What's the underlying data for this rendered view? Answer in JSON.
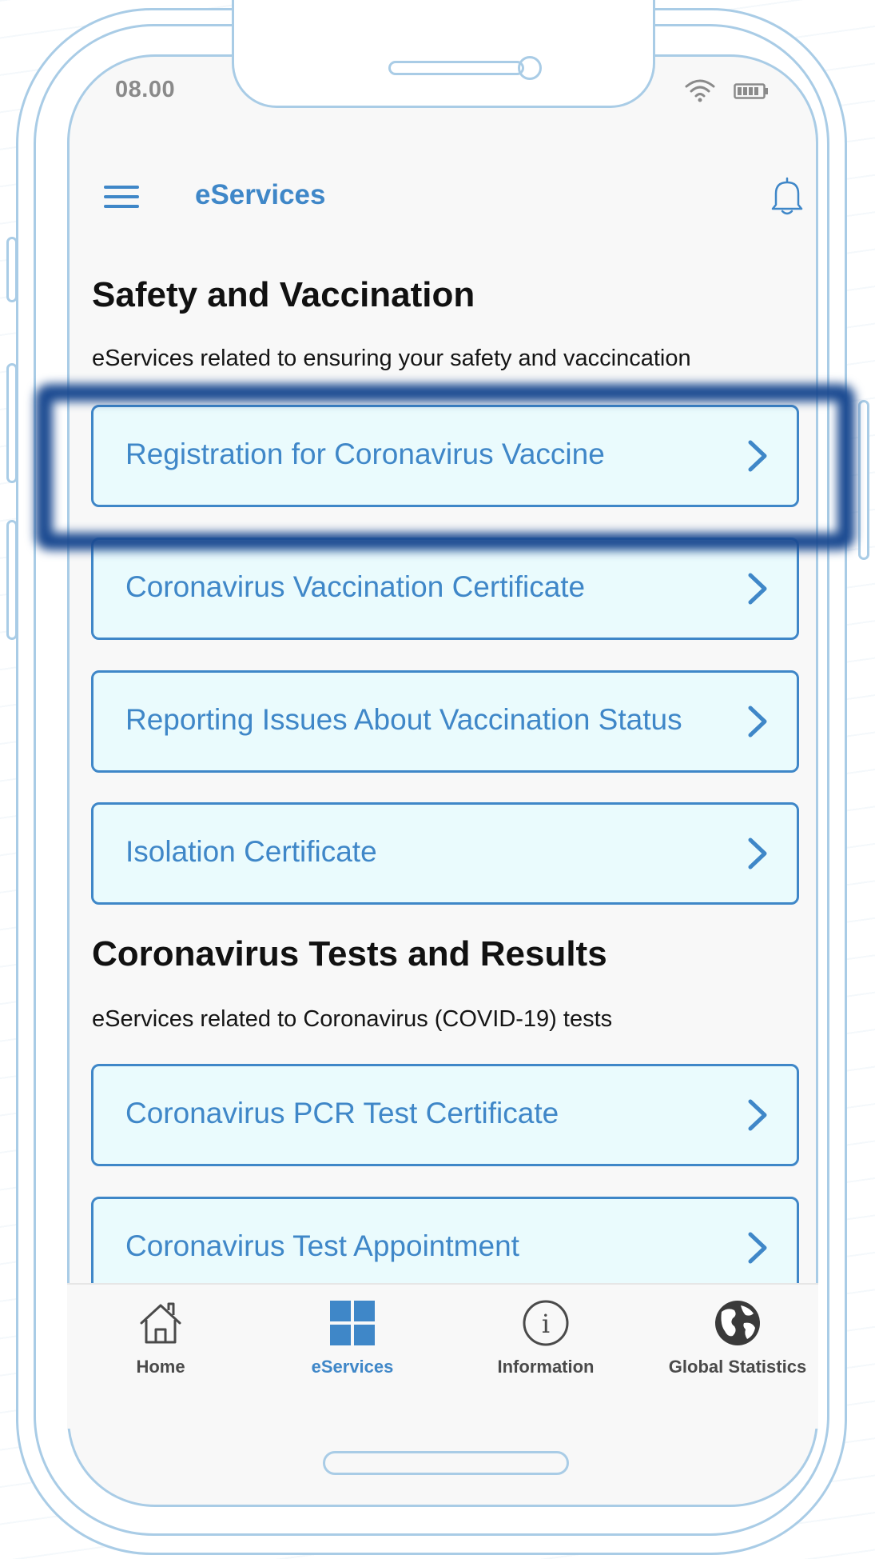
{
  "status_bar": {
    "time": "08.00"
  },
  "header": {
    "title": "eServices"
  },
  "sections": [
    {
      "title": "Safety and Vaccination",
      "description": "eServices related to ensuring your safety and vaccincation",
      "items": [
        {
          "label": "Registration for Coronavirus Vaccine"
        },
        {
          "label": "Coronavirus Vaccination Certificate"
        },
        {
          "label": "Reporting Issues About Vaccination Status"
        },
        {
          "label": "Isolation Certificate"
        }
      ]
    },
    {
      "title": "Coronavirus Tests and Results",
      "description": "eServices related to Coronavirus (COVID-19) tests",
      "items": [
        {
          "label": "Coronavirus PCR Test Certificate"
        },
        {
          "label": "Coronavirus Test Appointment"
        }
      ]
    }
  ],
  "bottom_nav": {
    "items": [
      {
        "label": "Home",
        "icon": "home-icon"
      },
      {
        "label": "eServices",
        "icon": "grid-icon",
        "active": true
      },
      {
        "label": "Information",
        "icon": "info-icon"
      },
      {
        "label": "Global Statistics",
        "icon": "globe-icon"
      }
    ]
  },
  "colors": {
    "accent": "#3f87c8",
    "card_background": "#eafbfd",
    "highlight": "#1b4a91",
    "frame": "#a9cce6"
  }
}
